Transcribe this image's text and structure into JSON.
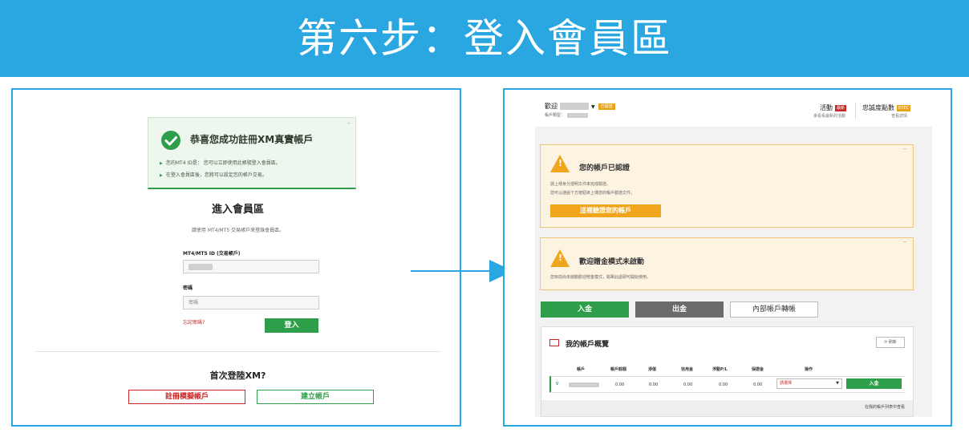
{
  "banner": {
    "title": "第六步：登入會員區"
  },
  "login_page": {
    "success": {
      "title": "恭喜您成功註冊XM真實帳戶",
      "line1": "您的MT4 ID是：            您可以立即使用此帳號登入會員區。",
      "line2": "在登入會員區後，您將可以設定您的帳戶交易。",
      "minimize": "–"
    },
    "title": "進入會員區",
    "subtitle": "請使用 MT4/MT5 交易帳戶來登錄會員區。",
    "id_label": "MT4/MT5 ID (交易帳戶)",
    "password_label": "密碼",
    "password_placeholder": "密碼",
    "forgot": "忘記密碼?",
    "login_button": "登入",
    "first_login": "首次登陸XM?",
    "demo_button": "註冊模擬帳戶",
    "create_button": "建立帳戶"
  },
  "dashboard": {
    "welcome": "歡迎",
    "verified_tag": "已驗證",
    "welcome_sub": "帳戶類型：",
    "activity": "活動",
    "activity_tag": "最新",
    "activity_sub": "來看看最新的活動",
    "loyalty": "忠誠度點數",
    "loyalty_tag": "EXEC",
    "loyalty_sub": "查看詳情",
    "alert_verified": {
      "title": "您的帳戶已認證",
      "line1": "請上傳身分證明文件來完成驗證。",
      "line2": "您可以通過下方按鈕來上傳您的帳戶驗證文件。",
      "button": "這裡驗證您的帳戶",
      "minimize": "–"
    },
    "alert_bonus": {
      "title": "歡迎贈金模式未啟動",
      "line1": "您目前尚未啟動歡迎贈金模式，點擊此處即可開始使用。",
      "minimize": "–"
    },
    "deposit_button": "入金",
    "withdraw_button": "出金",
    "transfer_button": "內部帳戶轉帳",
    "overview": {
      "title": "我的帳戶概覽",
      "refresh": "⟳ 刷新",
      "headers": [
        "帳戶",
        "帳戶餘額",
        "淨值",
        "信用金",
        "浮動P/L",
        "保證金",
        "操作"
      ],
      "row": {
        "balance": "0.00",
        "equity": "0.00",
        "credit": "0.00",
        "float": "0.00",
        "margin": "0.00",
        "action": "請選擇",
        "deposit": "入金"
      },
      "footer": "在我的帳戶列表中查看"
    }
  }
}
